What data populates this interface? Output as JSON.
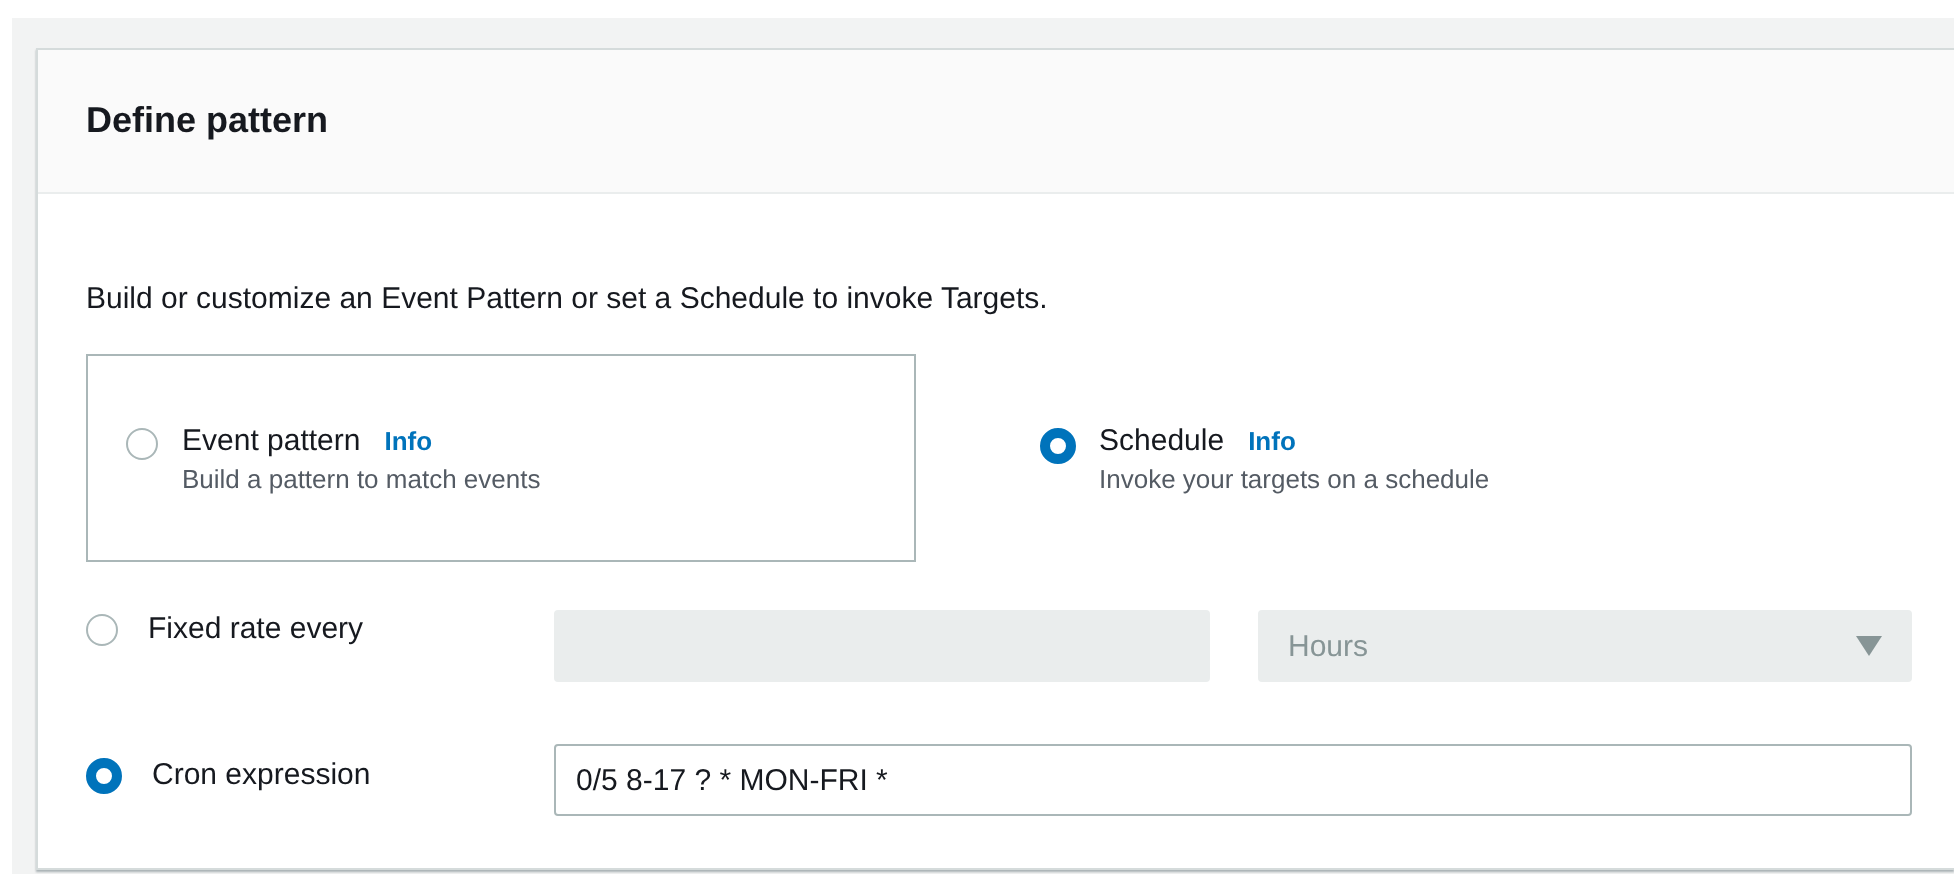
{
  "panel": {
    "title": "Define pattern",
    "description": "Build or customize an Event Pattern or set a Schedule to invoke Targets."
  },
  "pattern_options": [
    {
      "label": "Event pattern",
      "info": "Info",
      "hint": "Build a pattern to match events",
      "selected": false
    },
    {
      "label": "Schedule",
      "info": "Info",
      "hint": "Invoke your targets on a schedule",
      "selected": true
    }
  ],
  "schedule_options": [
    {
      "kind": "rate",
      "label": "Fixed rate every",
      "selected": false,
      "disabled": true,
      "unit": "Hours"
    },
    {
      "kind": "cron",
      "label": "Cron expression",
      "selected": true,
      "disabled": false,
      "value": "0/5 8-17 ? * MON-FRI *"
    }
  ]
}
